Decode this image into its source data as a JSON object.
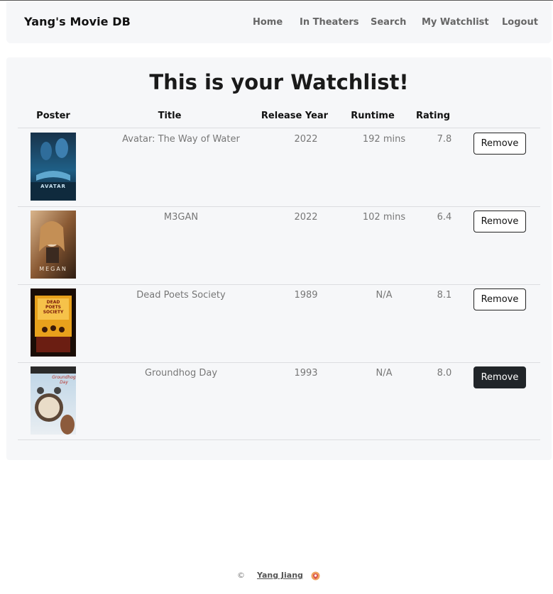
{
  "nav": {
    "brand": "Yang's Movie DB",
    "links": [
      "Home",
      "In Theaters",
      "Search",
      "My Watchlist",
      "Logout"
    ]
  },
  "page": {
    "title": "This is your Watchlist!"
  },
  "table": {
    "columns": [
      "Poster",
      "Title",
      "Release Year",
      "Runtime",
      "Rating",
      ""
    ],
    "rows": [
      {
        "poster_text": "AVATAR",
        "title": "Avatar: The Way of Water",
        "year": "2022",
        "runtime": "192 mins",
        "rating": "7.8",
        "action": "Remove"
      },
      {
        "poster_text": "MEGAN",
        "title": "M3GAN",
        "year": "2022",
        "runtime": "102 mins",
        "rating": "6.4",
        "action": "Remove"
      },
      {
        "poster_text": "DEAD POETS SOCIETY",
        "title": "Dead Poets Society",
        "year": "1989",
        "runtime": "N/A",
        "rating": "8.1",
        "action": "Remove"
      },
      {
        "poster_text": "Groundhog Day",
        "title": "Groundhog Day",
        "year": "1993",
        "runtime": "N/A",
        "rating": "8.0",
        "action": "Remove"
      }
    ]
  },
  "footer": {
    "copyright_symbol": "©",
    "author": "Yang Jiang",
    "icon": "github-icon"
  }
}
